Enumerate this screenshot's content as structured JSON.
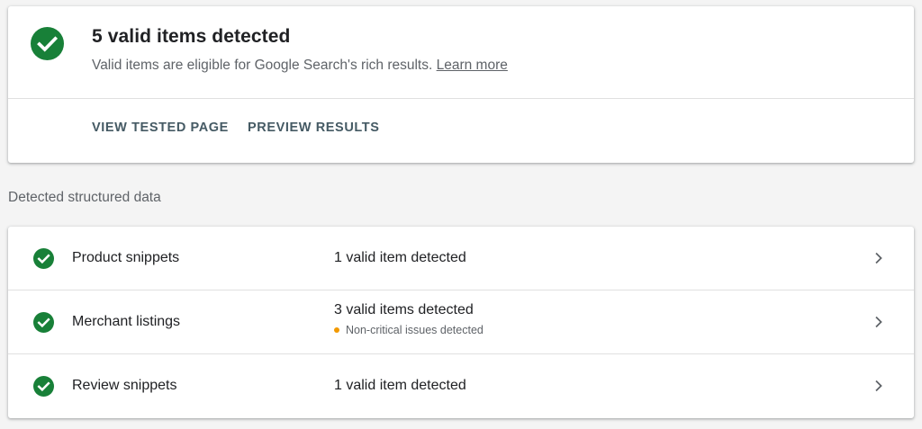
{
  "summary": {
    "title": "5 valid items detected",
    "description": "Valid items are eligible for Google Search's rich results.",
    "learn_more": "Learn more",
    "actions": {
      "view_tested_page": "VIEW TESTED PAGE",
      "preview_results": "PREVIEW RESULTS"
    },
    "icon": "check-circle-icon",
    "status_color": "#188038"
  },
  "section_label": "Detected structured data",
  "items": [
    {
      "label": "Product snippets",
      "status": "1 valid item detected",
      "icon": "check-circle-icon"
    },
    {
      "label": "Merchant listings",
      "status": "3 valid items detected",
      "sub_status": "Non-critical issues detected",
      "icon": "check-circle-icon"
    },
    {
      "label": "Review snippets",
      "status": "1 valid item detected",
      "icon": "check-circle-icon"
    }
  ],
  "colors": {
    "valid": "#188038",
    "warning": "#f29900",
    "action": "#455a64"
  }
}
